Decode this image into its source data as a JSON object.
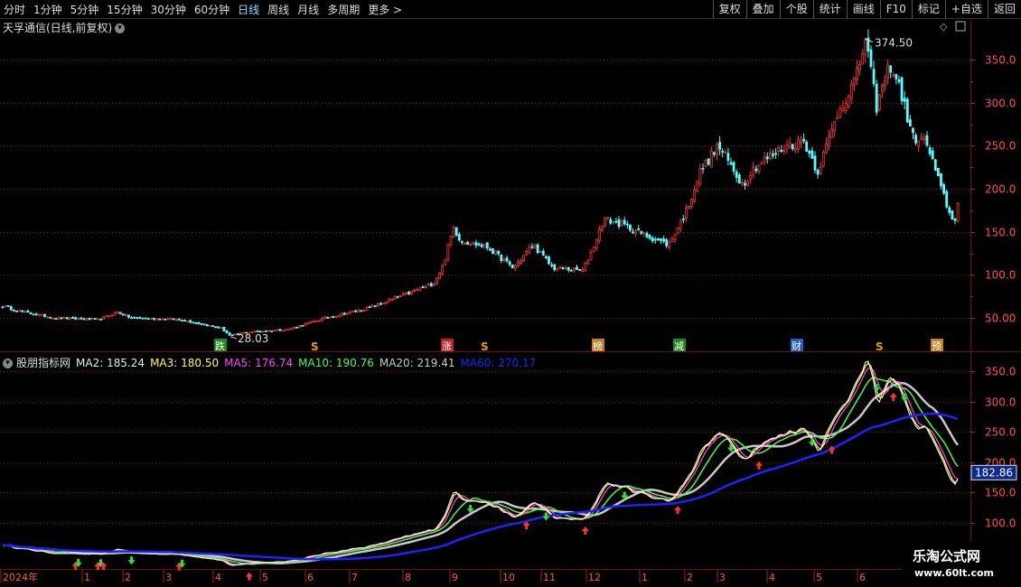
{
  "toolbar": {
    "periods": [
      "分时",
      "1分钟",
      "5分钟",
      "15分钟",
      "30分钟",
      "60分钟",
      "日线",
      "周线",
      "月线",
      "多周期",
      "更多"
    ],
    "active_period": "日线",
    "right_buttons": [
      "复权",
      "叠加",
      "个股",
      "统计",
      "画线",
      "F10",
      "标记",
      "+自选",
      "返回"
    ]
  },
  "main_pane": {
    "title": "天孚通信(日线,前复权)",
    "high_label": "374.50",
    "low_label": "28.03",
    "y_ticks": [
      "350.0",
      "300.0",
      "250.0",
      "200.0",
      "150.0",
      "100.0",
      "50.00"
    ],
    "event_marks": [
      {
        "label": "跌",
        "color": "#1a8a1a"
      },
      {
        "label": "S",
        "color": "#e0a000"
      },
      {
        "label": "涨",
        "color": "#c02020"
      },
      {
        "label": "S",
        "color": "#e0a000"
      },
      {
        "label": "榜",
        "color": "#c08020"
      },
      {
        "label": "减",
        "color": "#1a8a1a"
      },
      {
        "label": "财",
        "color": "#2060c0"
      },
      {
        "label": "S",
        "color": "#e0a000"
      },
      {
        "label": "预",
        "color": "#c08020"
      }
    ]
  },
  "indicator_pane": {
    "title": "股朋指标网",
    "legend": [
      {
        "label": "MA2: 185.24",
        "color": "#e8e8e8"
      },
      {
        "label": "MA3: 180.50",
        "color": "#ffff40"
      },
      {
        "label": "MA5: 176.74",
        "color": "#ff40ff"
      },
      {
        "label": "MA10: 190.76",
        "color": "#40ff40"
      },
      {
        "label": "MA20: 219.41",
        "color": "#c8c8c8"
      },
      {
        "label": "MA60: 270.17",
        "color": "#2020ff"
      }
    ],
    "y_ticks": [
      "350.0",
      "300.0",
      "250.0",
      "200.0",
      "150.0",
      "100.0"
    ],
    "current_value": "182.86"
  },
  "x_axis": {
    "labels": [
      "2024年",
      "1",
      "2",
      "3",
      "4",
      "5",
      "6",
      "7",
      "8",
      "9",
      "10",
      "11",
      "12",
      "1",
      "2",
      "3",
      "4",
      "5",
      "6"
    ]
  },
  "watermark": {
    "line1": "乐淘公式网",
    "line2": "www.60lt.com"
  },
  "colors": {
    "up": "#ff3232",
    "down": "#54ffff",
    "grid": "#7a1010",
    "axis_text": "#ff5050"
  },
  "chart_data": {
    "type": "candlestick",
    "title": "天孚通信(日线,前复权)",
    "ylim": [
      0,
      390
    ],
    "price_path": [
      [
        0,
        65
      ],
      [
        20,
        58
      ],
      [
        60,
        50
      ],
      [
        110,
        48
      ],
      [
        130,
        57
      ],
      [
        145,
        50
      ],
      [
        200,
        48
      ],
      [
        245,
        38
      ],
      [
        255,
        29
      ],
      [
        270,
        33
      ],
      [
        320,
        37
      ],
      [
        360,
        50
      ],
      [
        410,
        62
      ],
      [
        450,
        78
      ],
      [
        480,
        90
      ],
      [
        490,
        110
      ],
      [
        502,
        155
      ],
      [
        510,
        140
      ],
      [
        540,
        132
      ],
      [
        568,
        108
      ],
      [
        590,
        135
      ],
      [
        612,
        108
      ],
      [
        645,
        105
      ],
      [
        655,
        128
      ],
      [
        668,
        165
      ],
      [
        690,
        158
      ],
      [
        710,
        148
      ],
      [
        740,
        135
      ],
      [
        760,
        175
      ],
      [
        775,
        220
      ],
      [
        795,
        250
      ],
      [
        822,
        205
      ],
      [
        835,
        225
      ],
      [
        870,
        250
      ],
      [
        890,
        255
      ],
      [
        905,
        220
      ],
      [
        928,
        290
      ],
      [
        948,
        330
      ],
      [
        958,
        374.5
      ],
      [
        970,
        295
      ],
      [
        985,
        345
      ],
      [
        995,
        320
      ],
      [
        1010,
        260
      ],
      [
        1025,
        255
      ],
      [
        1040,
        205
      ],
      [
        1055,
        160
      ],
      [
        1062,
        180
      ]
    ],
    "high": 374.5,
    "low": 28.03,
    "ma_series": [
      {
        "name": "MA2",
        "last": 185.24
      },
      {
        "name": "MA3",
        "last": 180.5
      },
      {
        "name": "MA5",
        "last": 176.74
      },
      {
        "name": "MA10",
        "last": 190.76
      },
      {
        "name": "MA20",
        "last": 219.41
      },
      {
        "name": "MA60",
        "last": 270.17
      }
    ]
  }
}
